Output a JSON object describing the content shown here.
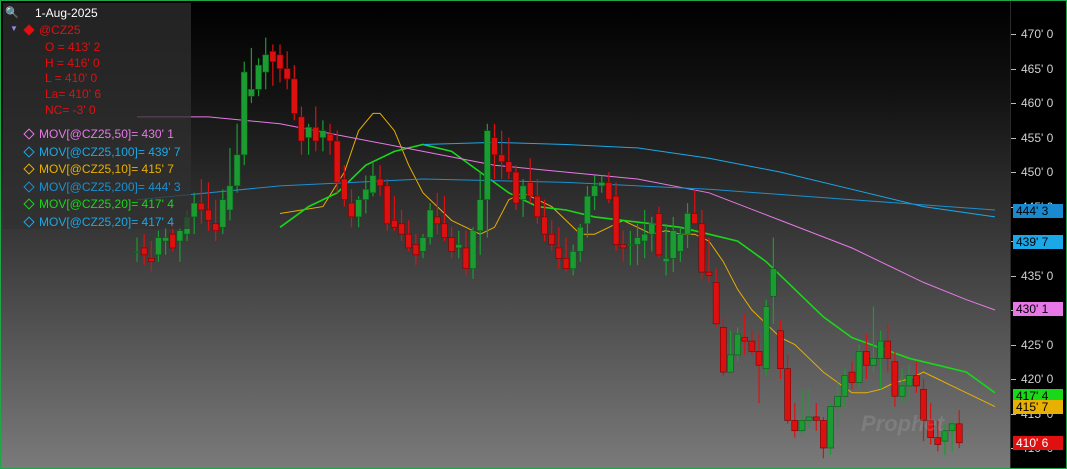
{
  "header": {
    "date": "1-Aug-2025"
  },
  "symbol": {
    "name": "@CZ25",
    "color": "#e01010"
  },
  "ohlc": [
    {
      "text": "O = 413' 2"
    },
    {
      "text": "H = 416' 0"
    },
    {
      "text": "L = 410' 0"
    },
    {
      "text": "La= 410' 6"
    },
    {
      "text": "NC= -3' 0"
    }
  ],
  "studies": [
    {
      "text": "MOV[@CZ25,50]= 430' 1",
      "color": "#e878e8"
    },
    {
      "text": "MOV[@CZ25,100]= 439' 7",
      "color": "#1aa8e8"
    },
    {
      "text": "MOV[@CZ25,10]= 415' 7",
      "color": "#e8b000"
    },
    {
      "text": "MOV[@CZ25,200]= 444' 3",
      "color": "#1a90d0"
    },
    {
      "text": "MOV[@CZ25,20]= 417' 4",
      "color": "#18d818"
    },
    {
      "text": "MOV[@CZ25,20]= 417' 4",
      "color": "#1aa8e8"
    }
  ],
  "badges": [
    {
      "text": "444' 3",
      "value": 444.375,
      "bg": "#1a8ad0",
      "fg": "#000000"
    },
    {
      "text": "439' 7",
      "value": 439.875,
      "bg": "#1aa8e8",
      "fg": "#000000"
    },
    {
      "text": "430' 1",
      "value": 430.125,
      "bg": "#e878e8",
      "fg": "#000000"
    },
    {
      "text": "417' 4",
      "value": 417.5,
      "bg": "#18d818",
      "fg": "#000000"
    },
    {
      "text": "415' 7",
      "value": 415.875,
      "bg": "#e8b000",
      "fg": "#000000"
    },
    {
      "text": "410' 6",
      "value": 410.75,
      "bg": "#e01010",
      "fg": "#ffffff"
    }
  ],
  "watermark": "Prophet",
  "chart_data": {
    "type": "candlestick",
    "y_ticks": [
      {
        "value": 470,
        "label": "470' 0"
      },
      {
        "value": 465,
        "label": "465' 0"
      },
      {
        "value": 460,
        "label": "460' 0"
      },
      {
        "value": 455,
        "label": "455' 0"
      },
      {
        "value": 450,
        "label": "450' 0"
      },
      {
        "value": 445,
        "label": "445' 0"
      },
      {
        "value": 440,
        "label": "440' 0"
      },
      {
        "value": 435,
        "label": "435' 0"
      },
      {
        "value": 430,
        "label": "430' 0"
      },
      {
        "value": 425,
        "label": "425' 0"
      },
      {
        "value": 420,
        "label": "420' 0"
      },
      {
        "value": 415,
        "label": "415' 0"
      },
      {
        "value": 410,
        "label": "410' 0"
      }
    ],
    "ylim": [
      407.1,
      474.8
    ],
    "candles": [
      [
        438.5,
        440.5,
        437,
        438.5
      ],
      [
        439,
        441,
        436.5,
        438
      ],
      [
        437.5,
        440,
        435.5,
        437
      ],
      [
        438,
        441.5,
        437,
        440.5
      ],
      [
        440,
        442,
        438,
        440.5
      ],
      [
        441,
        443,
        438.5,
        439
      ],
      [
        440,
        442,
        437,
        441.5
      ],
      [
        441,
        444.5,
        440,
        443.5
      ],
      [
        443.5,
        447,
        441,
        445.5
      ],
      [
        445.5,
        449,
        442.5,
        444.5
      ],
      [
        444.5,
        448.5,
        441.5,
        443
      ],
      [
        442.5,
        446,
        440,
        441.5
      ],
      [
        442,
        447.5,
        441,
        446
      ],
      [
        444.5,
        453.5,
        443,
        448
      ],
      [
        448,
        457,
        447,
        452.5
      ],
      [
        452.5,
        466,
        451,
        464.5
      ],
      [
        461,
        468,
        460,
        462
      ],
      [
        462,
        466.5,
        461,
        465.5
      ],
      [
        464.5,
        469.5,
        462,
        467
      ],
      [
        467.5,
        468.5,
        462.5,
        466
      ],
      [
        467,
        468.5,
        463,
        465
      ],
      [
        465,
        467.5,
        462,
        463.5
      ],
      [
        463.5,
        465.5,
        457.5,
        458.5
      ],
      [
        458,
        459.5,
        452.5,
        454.5
      ],
      [
        455,
        457,
        452.5,
        456.5
      ],
      [
        456.5,
        459.5,
        453,
        454.5
      ],
      [
        455,
        457.5,
        453,
        456
      ],
      [
        455.5,
        457,
        452.5,
        454.5
      ],
      [
        454.5,
        456,
        447,
        448.5
      ],
      [
        449,
        451,
        445,
        446
      ],
      [
        445.5,
        447.5,
        442,
        443.5
      ],
      [
        443.5,
        446.5,
        442,
        446
      ],
      [
        446,
        449.5,
        444,
        447.5
      ],
      [
        447,
        451.5,
        446.5,
        449.5
      ],
      [
        449,
        451,
        446.5,
        448
      ],
      [
        448,
        449,
        441.5,
        442.5
      ],
      [
        443,
        446.5,
        441.5,
        442
      ],
      [
        442.5,
        444.5,
        440,
        441
      ],
      [
        441,
        443,
        438.5,
        439
      ],
      [
        439.5,
        441,
        436.5,
        438
      ],
      [
        438.5,
        441,
        437.5,
        440.5
      ],
      [
        440.5,
        445.5,
        439.5,
        444.5
      ],
      [
        443.5,
        447,
        441,
        442.5
      ],
      [
        442.5,
        446.5,
        440,
        440.5
      ],
      [
        440.5,
        442,
        437.5,
        438.5
      ],
      [
        439,
        441.5,
        437.5,
        439.5
      ],
      [
        439,
        441.5,
        435,
        436
      ],
      [
        436,
        442,
        434.5,
        441.5
      ],
      [
        441.5,
        450,
        438,
        446
      ],
      [
        446,
        457,
        440.5,
        456
      ],
      [
        455,
        457,
        449,
        452.5
      ],
      [
        452.5,
        456,
        449,
        451.5
      ],
      [
        451.5,
        455,
        449,
        450
      ],
      [
        450,
        451,
        444.5,
        445.5
      ],
      [
        446,
        449,
        443.5,
        448
      ],
      [
        448.5,
        452,
        445.5,
        446.5
      ],
      [
        446.5,
        449,
        442.5,
        443.5
      ],
      [
        443.5,
        446,
        440,
        441
      ],
      [
        441,
        443,
        438.5,
        439.5
      ],
      [
        439,
        442,
        436,
        437.5
      ],
      [
        437.5,
        440.5,
        435.5,
        436
      ],
      [
        436,
        439.5,
        435,
        438.5
      ],
      [
        438.5,
        442.5,
        437,
        442
      ],
      [
        442.5,
        448,
        440.5,
        446.5
      ],
      [
        446.5,
        449.5,
        444.5,
        448
      ],
      [
        448,
        449.5,
        447,
        448.5
      ],
      [
        448.5,
        450,
        445.5,
        446
      ],
      [
        446.5,
        448.5,
        438.5,
        439.5
      ],
      [
        439.5,
        441.5,
        437,
        439
      ],
      [
        439.5,
        441.5,
        436.5,
        439.5
      ],
      [
        439.5,
        442.5,
        436.5,
        440.5
      ],
      [
        440,
        444.5,
        437.5,
        441
      ],
      [
        441,
        443.5,
        438.5,
        442.5
      ],
      [
        444,
        445,
        437.5,
        438
      ],
      [
        437,
        442.5,
        435,
        437.5
      ],
      [
        437.5,
        443.5,
        435.5,
        441.5
      ],
      [
        438.5,
        442,
        437,
        441
      ],
      [
        441,
        445.5,
        439,
        444
      ],
      [
        444,
        447.5,
        443,
        442.5
      ],
      [
        442.5,
        444.5,
        434.5,
        435.5
      ],
      [
        435.5,
        440.5,
        434,
        435
      ],
      [
        434,
        436,
        427.5,
        428
      ],
      [
        427.5,
        429,
        420.5,
        421
      ],
      [
        421,
        427,
        421.5,
        423.5
      ],
      [
        423.5,
        427.5,
        422.5,
        426.5
      ],
      [
        426,
        429.5,
        423.5,
        425.5
      ],
      [
        425.5,
        427,
        423.5,
        424
      ],
      [
        424,
        426.5,
        416.5,
        422
      ],
      [
        421.5,
        431.5,
        420.5,
        430.5
      ],
      [
        432,
        440.5,
        428,
        436
      ],
      [
        427,
        428.5,
        420,
        421.5
      ],
      [
        421.5,
        423.5,
        413.5,
        414
      ],
      [
        414,
        416.5,
        411.5,
        412.5
      ],
      [
        412.5,
        418.5,
        412,
        414
      ],
      [
        414,
        418.5,
        413,
        414.5
      ],
      [
        414.5,
        416.5,
        412.5,
        414
      ],
      [
        414,
        414.5,
        408.5,
        410
      ],
      [
        410,
        416.5,
        409,
        416
      ],
      [
        416,
        419.5,
        413,
        417.5
      ],
      [
        417.5,
        421.5,
        416,
        420.5
      ],
      [
        421,
        422.5,
        418.5,
        419.5
      ],
      [
        419.5,
        425,
        418.5,
        424
      ],
      [
        424,
        426.5,
        420,
        422
      ],
      [
        422,
        430.5,
        421,
        423
      ],
      [
        423,
        427,
        418.5,
        425.5
      ],
      [
        425.5,
        428,
        421,
        423
      ],
      [
        422.5,
        424,
        416,
        417.5
      ],
      [
        417.5,
        421.5,
        416.5,
        419
      ],
      [
        419,
        422,
        417,
        420.5
      ],
      [
        420.5,
        422.5,
        418,
        419
      ],
      [
        418.5,
        420,
        411,
        414
      ],
      [
        414,
        416.5,
        410.5,
        411.5
      ],
      [
        411.5,
        414,
        409.5,
        410.5
      ],
      [
        411,
        413.5,
        409,
        412.5
      ],
      [
        412.5,
        414,
        409.5,
        413.5
      ],
      [
        413.5,
        415.5,
        410,
        410.75
      ]
    ],
    "moving_averages": [
      {
        "label": "MOV 10",
        "color": "#e8b000",
        "points": [
          [
            20,
            444
          ],
          [
            26,
            445
          ],
          [
            29,
            450
          ],
          [
            31,
            456
          ],
          [
            33,
            458.5
          ],
          [
            34,
            458.5
          ],
          [
            36,
            456
          ],
          [
            38,
            451
          ],
          [
            40,
            447
          ],
          [
            42,
            445
          ],
          [
            44,
            443
          ],
          [
            46,
            442
          ],
          [
            48,
            441
          ],
          [
            50,
            442
          ],
          [
            52,
            446
          ],
          [
            54,
            447
          ],
          [
            56,
            446
          ],
          [
            58,
            445
          ],
          [
            60,
            443
          ],
          [
            62,
            441
          ],
          [
            64,
            441
          ],
          [
            66,
            442
          ],
          [
            68,
            443
          ],
          [
            70,
            442
          ],
          [
            72,
            441
          ],
          [
            74,
            441.5
          ],
          [
            76,
            441
          ],
          [
            78,
            441
          ],
          [
            80,
            440
          ],
          [
            82,
            437
          ],
          [
            84,
            433
          ],
          [
            86,
            430
          ],
          [
            88,
            428
          ],
          [
            90,
            426
          ],
          [
            92,
            425
          ],
          [
            94,
            423
          ],
          [
            96,
            421
          ],
          [
            98,
            419.5
          ],
          [
            100,
            418
          ],
          [
            102,
            418
          ],
          [
            104,
            418.5
          ],
          [
            106,
            419.5
          ],
          [
            108,
            420
          ],
          [
            110,
            421
          ],
          [
            112,
            420
          ],
          [
            114,
            419
          ],
          [
            116,
            418
          ],
          [
            118,
            417
          ],
          [
            120,
            416
          ]
        ]
      },
      {
        "label": "MOV 20",
        "color": "#18d818",
        "points": [
          [
            20,
            442
          ],
          [
            24,
            445
          ],
          [
            28,
            447
          ],
          [
            32,
            451
          ],
          [
            36,
            453
          ],
          [
            40,
            454
          ],
          [
            44,
            453
          ],
          [
            48,
            450
          ],
          [
            52,
            447
          ],
          [
            56,
            445
          ],
          [
            60,
            444.5
          ],
          [
            64,
            443.5
          ],
          [
            68,
            443
          ],
          [
            72,
            442.5
          ],
          [
            76,
            442
          ],
          [
            80,
            441
          ],
          [
            84,
            440
          ],
          [
            88,
            437
          ],
          [
            92,
            433
          ],
          [
            96,
            429
          ],
          [
            100,
            426
          ],
          [
            104,
            424.5
          ],
          [
            108,
            423
          ],
          [
            112,
            422
          ],
          [
            116,
            421
          ],
          [
            120,
            418
          ]
        ]
      },
      {
        "label": "MOV 50",
        "color": "#e878e8",
        "points": [
          [
            0,
            458
          ],
          [
            10,
            458
          ],
          [
            20,
            457
          ],
          [
            30,
            455
          ],
          [
            40,
            453
          ],
          [
            50,
            451
          ],
          [
            60,
            450
          ],
          [
            70,
            449
          ],
          [
            80,
            447
          ],
          [
            90,
            443
          ],
          [
            100,
            439
          ],
          [
            110,
            434
          ],
          [
            116,
            431.5
          ],
          [
            120,
            430
          ]
        ]
      },
      {
        "label": "MOV 100",
        "color": "#1aa8e8",
        "points": [
          [
            40,
            454
          ],
          [
            50,
            454.3
          ],
          [
            60,
            454
          ],
          [
            70,
            453.5
          ],
          [
            80,
            452
          ],
          [
            90,
            450
          ],
          [
            100,
            447.5
          ],
          [
            110,
            445
          ],
          [
            120,
            443.5
          ]
        ]
      },
      {
        "label": "MOV 200",
        "color": "#1a90d0",
        "points": [
          [
            0,
            446
          ],
          [
            20,
            448
          ],
          [
            40,
            449
          ],
          [
            60,
            448.5
          ],
          [
            80,
            447.5
          ],
          [
            100,
            446
          ],
          [
            120,
            444.5
          ]
        ]
      }
    ],
    "grid": false,
    "legend_position": "top-left"
  }
}
